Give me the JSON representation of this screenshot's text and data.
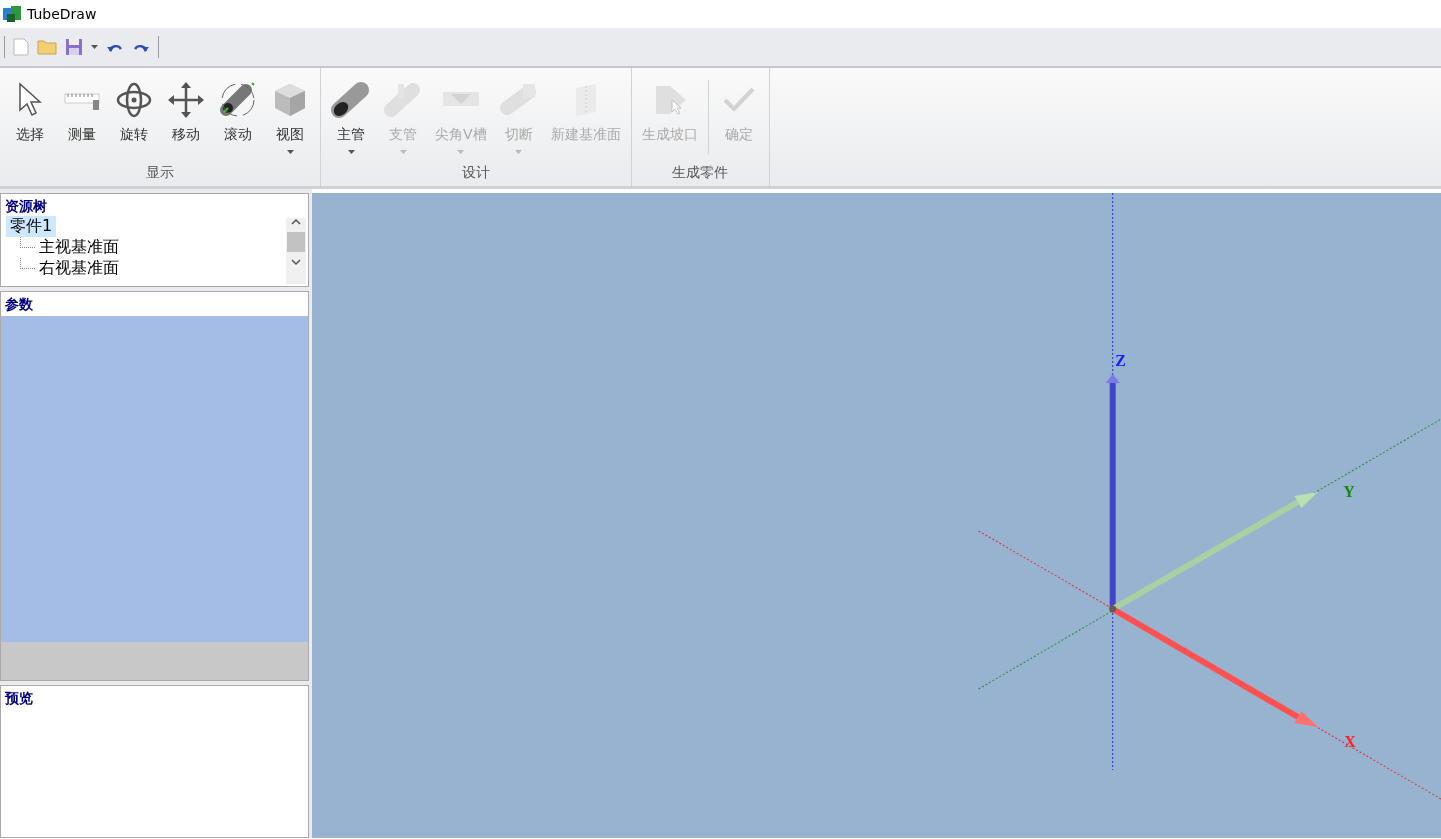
{
  "window": {
    "title": "TubeDraw"
  },
  "quick_access": [
    {
      "kind": "new"
    },
    {
      "kind": "open"
    },
    {
      "kind": "save"
    },
    {
      "kind": "dropdown"
    },
    {
      "kind": "undo"
    },
    {
      "kind": "redo"
    }
  ],
  "ribbon": {
    "groups": [
      {
        "label": "显示",
        "buttons": [
          {
            "kind": "select",
            "label": "选择",
            "disabled": false,
            "dropdown": false
          },
          {
            "kind": "measure",
            "label": "测量",
            "disabled": false,
            "dropdown": false
          },
          {
            "kind": "rotate",
            "label": "旋转",
            "disabled": false,
            "dropdown": false
          },
          {
            "kind": "move",
            "label": "移动",
            "disabled": false,
            "dropdown": false
          },
          {
            "kind": "roll",
            "label": "滚动",
            "disabled": false,
            "dropdown": false
          },
          {
            "kind": "view",
            "label": "视图",
            "disabled": false,
            "dropdown": true
          }
        ]
      },
      {
        "label": "设计",
        "buttons": [
          {
            "kind": "tube",
            "label": "主管",
            "disabled": false,
            "dropdown": true
          },
          {
            "kind": "branch",
            "label": "支管",
            "disabled": true,
            "dropdown": true
          },
          {
            "kind": "vgroove",
            "label": "尖角V槽",
            "disabled": true,
            "dropdown": true
          },
          {
            "kind": "cut",
            "label": "切断",
            "disabled": true,
            "dropdown": true
          },
          {
            "kind": "plane",
            "label": "新建基准面",
            "disabled": true,
            "dropdown": false
          }
        ]
      },
      {
        "label": "生成零件",
        "buttons": [
          {
            "kind": "bevel",
            "label": "生成坡口",
            "disabled": true,
            "dropdown": false
          },
          {
            "kind": "ok",
            "label": "确定",
            "disabled": true,
            "dropdown": false
          }
        ]
      }
    ]
  },
  "resource_tree": {
    "title": "资源树",
    "items": [
      {
        "label": "零件1",
        "selected": true,
        "children": [
          {
            "label": "主视基准面",
            "selected": false
          },
          {
            "label": "右视基准面",
            "selected": false
          }
        ]
      }
    ]
  },
  "parameters": {
    "title": "参数"
  },
  "preview": {
    "title": "预览"
  },
  "viewport": {
    "axes": [
      {
        "kind": "z",
        "label": "Z",
        "color": "#1a1aff"
      },
      {
        "kind": "y",
        "label": "Y",
        "color": "#118811"
      },
      {
        "kind": "x",
        "label": "X",
        "color": "#ff2020"
      }
    ]
  }
}
